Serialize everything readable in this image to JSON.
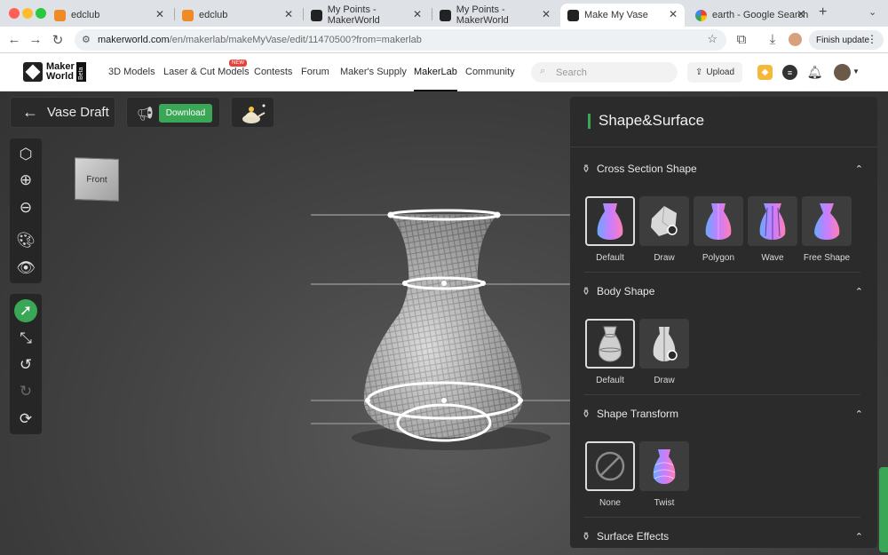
{
  "browser": {
    "tabs": [
      {
        "title": "edclub",
        "favicon": "edclub-icon"
      },
      {
        "title": "edclub",
        "favicon": "edclub-icon"
      },
      {
        "title": "My Points - MakerWorld",
        "favicon": "makerworld-icon"
      },
      {
        "title": "My Points - MakerWorld",
        "favicon": "makerworld-icon"
      },
      {
        "title": "Make My Vase",
        "favicon": "makerworld-icon"
      },
      {
        "title": "earth - Google Search",
        "favicon": "google-icon"
      }
    ],
    "new_tab": "+",
    "url_host": "makerworld.com",
    "url_path": "/en/makerlab/makeMyVase/edit/11470500?from=makerlab",
    "finish_update": "Finish update"
  },
  "header": {
    "logo_line1": "Maker",
    "logo_line2": "World",
    "logo_beta": "Beta",
    "nav": [
      "3D Models",
      "Laser & Cut Models",
      "Contests",
      "Forum",
      "Maker's Supply",
      "MakerLab",
      "Community"
    ],
    "new_badge": "NEW",
    "search_placeholder": "Search",
    "upload": "Upload"
  },
  "toolbar": {
    "draft_title": "Vase Draft",
    "download": "Download"
  },
  "viewport": {
    "cube_label": "Front"
  },
  "panel": {
    "title": "Shape&Surface",
    "sections": [
      {
        "title": "Cross Section Shape",
        "options": [
          "Default",
          "Draw",
          "Polygon",
          "Wave",
          "Free Shape"
        ]
      },
      {
        "title": "Body Shape",
        "options": [
          "Default",
          "Draw"
        ]
      },
      {
        "title": "Shape Transform",
        "options": [
          "None",
          "Twist"
        ]
      },
      {
        "title": "Surface Effects",
        "options": []
      }
    ]
  },
  "colors": {
    "accent": "#3aa756",
    "panel_bg": "#2b2b2b",
    "new_badge": "#e8413c"
  }
}
